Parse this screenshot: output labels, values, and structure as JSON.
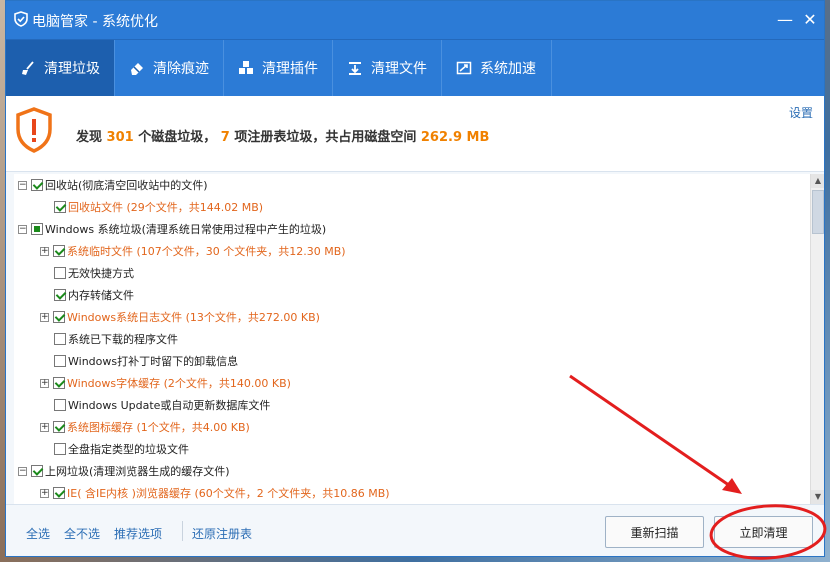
{
  "window": {
    "title": "电脑管家 - 系统优化",
    "min": "—",
    "close": "✕"
  },
  "tabs": [
    {
      "label": "清理垃圾",
      "icon": "broom-icon",
      "active": true
    },
    {
      "label": "清除痕迹",
      "icon": "eraser-icon"
    },
    {
      "label": "清理插件",
      "icon": "plugin-icon"
    },
    {
      "label": "清理文件",
      "icon": "download-file-icon"
    },
    {
      "label": "系统加速",
      "icon": "speedup-icon"
    }
  ],
  "header": {
    "p1": "发现",
    "disk_count": "301",
    "p2": "个磁盘垃圾，",
    "reg_count": "7",
    "p3": "项注册表垃圾，共占用磁盘空间",
    "size": "262.9 MB",
    "settings": "设置"
  },
  "list": {
    "recycle": {
      "label": "回收站(彻底清空回收站中的文件)",
      "child": "回收站文件 (29个文件，共144.02 MB)"
    },
    "windows": {
      "label": "Windows 系统垃圾(清理系统日常使用过程中产生的垃圾)",
      "items": [
        "系统临时文件 (107个文件，30 个文件夹，共12.30 MB)",
        "无效快捷方式",
        "内存转储文件",
        "Windows系统日志文件 (13个文件，共272.00 KB)",
        "系统已下载的程序文件",
        "Windows打补丁时留下的卸载信息",
        "Windows字体缓存 (2个文件，共140.00 KB)",
        "Windows Update或自动更新数据库文件",
        "系统图标缓存 (1个文件，共4.00 KB)",
        "全盘指定类型的垃圾文件"
      ]
    },
    "internet": {
      "label": "上网垃圾(清理浏览器生成的缓存文件)",
      "child": "IE( 含IE内核 )浏览器缓存 (60个文件，2 个文件夹，共10.86 MB)"
    }
  },
  "footer": {
    "select_all": "全选",
    "select_none": "全不选",
    "recommended": "推荐选项",
    "restore_registry": "还原注册表",
    "rescan": "重新扫描",
    "clean_now": "立即清理"
  },
  "colors": {
    "accent": "#2c7bd6",
    "highlight": "#f08100",
    "annotation": "#e31e1e"
  }
}
